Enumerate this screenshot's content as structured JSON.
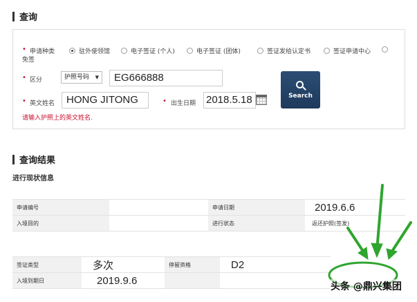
{
  "query": {
    "title": "查询",
    "application_type_label": "申请种类",
    "exempt_label": "免签",
    "options": [
      "驻外使领馆",
      "电子签证 (个人)",
      "电子签证 (团体)",
      "签证发给认定书",
      "签证申请中心"
    ],
    "selected_option_index": 0,
    "category_label": "区分",
    "category_select": "护照号码",
    "passport_value": "EG666888",
    "english_name_label": "英文姓名",
    "english_name_value": "HONG JITONG",
    "birth_label": "出生日期",
    "birth_value": "2018.5.18",
    "search_button": "Search",
    "hint": "请输入护照上的英文姓名."
  },
  "result": {
    "title": "查询结果",
    "subtitle": "进行现状信息",
    "rows1": {
      "application_no_label": "申请编号",
      "application_no_value": "",
      "application_date_label": "申请日期",
      "application_date_value": "2019.6.6",
      "purpose_label": "入境目的",
      "purpose_value": "",
      "status_label": "进行状态",
      "status_value": "返还护照(签发)"
    },
    "rows2": {
      "visa_type_label": "签证类型",
      "visa_type_value": "多次",
      "stay_label": "停留资格",
      "stay_value": "D2",
      "expiry_label": "入境到期日",
      "expiry_value": "2019.9.6"
    }
  },
  "watermark": "头条 @鼎兴集团",
  "colors": {
    "accent": "#1e3a5c",
    "required": "#c8102e",
    "annotation": "#2fa52f"
  }
}
